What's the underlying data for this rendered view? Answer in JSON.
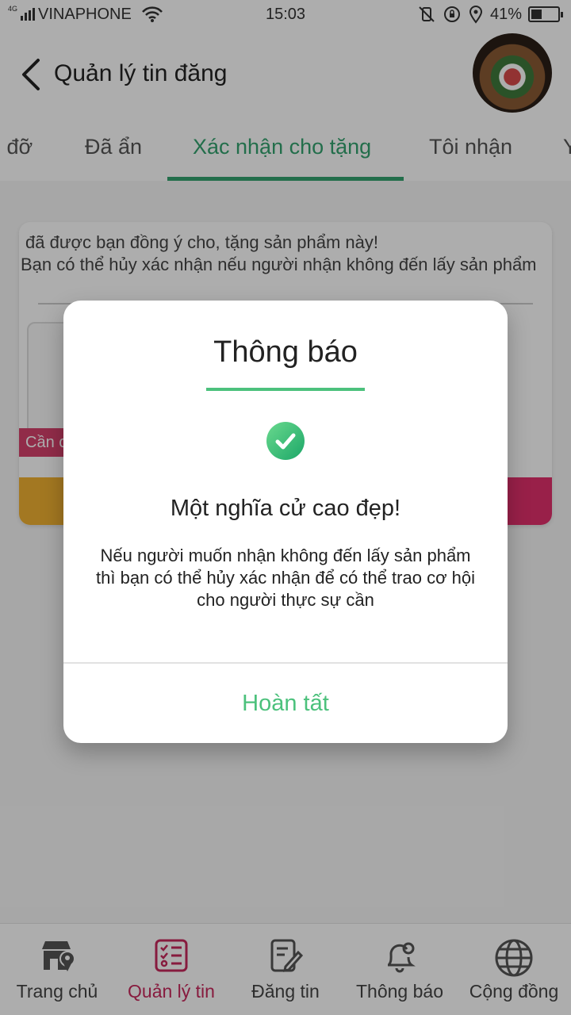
{
  "status_bar": {
    "network_type": "4G",
    "carrier": "VINAPHONE",
    "time": "15:03",
    "battery_percent": "41%",
    "battery_level": 0.41
  },
  "header": {
    "title": "Quản lý tin đăng",
    "back_icon": "chevron-left-icon"
  },
  "tabs": [
    {
      "label": "ỗ đỡ"
    },
    {
      "label": "Đã ẩn"
    },
    {
      "label": "Xác nhận cho tặng",
      "active": true
    },
    {
      "label": "Tôi nhận"
    },
    {
      "label": "Y"
    }
  ],
  "card": {
    "line1": "đã được bạn đồng ý cho, tặng sản phẩm này!",
    "line2": "Bạn có thể hủy xác nhận nếu người nhận không đến lấy sản phẩm",
    "badge": "Cần c"
  },
  "modal": {
    "title": "Thông báo",
    "heading": "Một nghĩa cử cao đẹp!",
    "body": "Nếu người muốn nhận không đến lấy sản phẩm thì bạn có thể hủy xác nhận để có thể trao cơ hội cho người thực sự cần",
    "button": "Hoàn tất",
    "accent_color": "#4cc17c"
  },
  "bottom_nav": [
    {
      "label": "Trang chủ",
      "icon": "store-location-icon"
    },
    {
      "label": "Quản lý tin",
      "icon": "checklist-icon",
      "active": true
    },
    {
      "label": "Đăng tin",
      "icon": "edit-document-icon"
    },
    {
      "label": "Thông báo",
      "icon": "bell-icon"
    },
    {
      "label": "Cộng đồng",
      "icon": "globe-icon"
    }
  ],
  "colors": {
    "tab_active": "#34a36f",
    "nav_active": "#c8285c"
  }
}
